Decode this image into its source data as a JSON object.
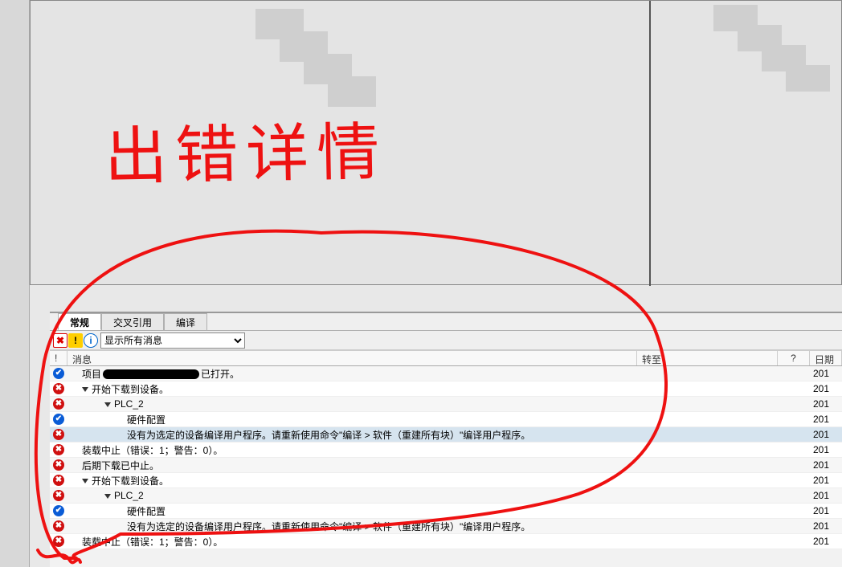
{
  "annotation": {
    "hand_text": "出错详情"
  },
  "tabs": [
    {
      "id": "general",
      "label": "常规",
      "active": true
    },
    {
      "id": "xref",
      "label": "交叉引用",
      "active": false
    },
    {
      "id": "compile",
      "label": "编译",
      "active": false
    }
  ],
  "toolbar": {
    "filter_err_title": "错误",
    "filter_warn_title": "警告",
    "filter_info_title": "信息",
    "dropdown_value": "显示所有消息"
  },
  "grid": {
    "headers": {
      "icon": "!",
      "msg": "消息",
      "goto": "转至",
      "q": "?",
      "date": "日期"
    },
    "rows": [
      {
        "status": "ok",
        "indent": 1,
        "arrow": false,
        "msg_prefix": "项目",
        "msg_redacted": true,
        "msg_suffix": "已打开。",
        "date": "201"
      },
      {
        "status": "err",
        "indent": 1,
        "arrow": true,
        "msg": "开始下载到设备。",
        "date": "201"
      },
      {
        "status": "err",
        "indent": 2,
        "arrow": true,
        "msg": "PLC_2",
        "date": "201"
      },
      {
        "status": "ok",
        "indent": 3,
        "arrow": false,
        "msg": "硬件配置",
        "date": "201"
      },
      {
        "status": "err",
        "indent": 3,
        "arrow": false,
        "msg": "没有为选定的设备编译用户程序。请重新使用命令\"编译 > 软件（重建所有块）\"编译用户程序。",
        "date": "201",
        "selected": true
      },
      {
        "status": "err",
        "indent": 1,
        "arrow": false,
        "msg": "装载中止（错误：1；警告：0）。",
        "date": "201"
      },
      {
        "status": "err",
        "indent": 1,
        "arrow": false,
        "msg": "后期下载已中止。",
        "date": "201"
      },
      {
        "status": "err",
        "indent": 1,
        "arrow": true,
        "msg": "开始下载到设备。",
        "date": "201"
      },
      {
        "status": "err",
        "indent": 2,
        "arrow": true,
        "msg": "PLC_2",
        "date": "201"
      },
      {
        "status": "ok",
        "indent": 3,
        "arrow": false,
        "msg": "硬件配置",
        "date": "201"
      },
      {
        "status": "err",
        "indent": 3,
        "arrow": false,
        "msg": "没有为选定的设备编译用户程序。请重新使用命令\"编译 > 软件（重建所有块）\"编译用户程序。",
        "date": "201"
      },
      {
        "status": "err",
        "indent": 1,
        "arrow": false,
        "msg": "装载中止（错误：1；警告：0）。",
        "date": "201"
      }
    ]
  }
}
